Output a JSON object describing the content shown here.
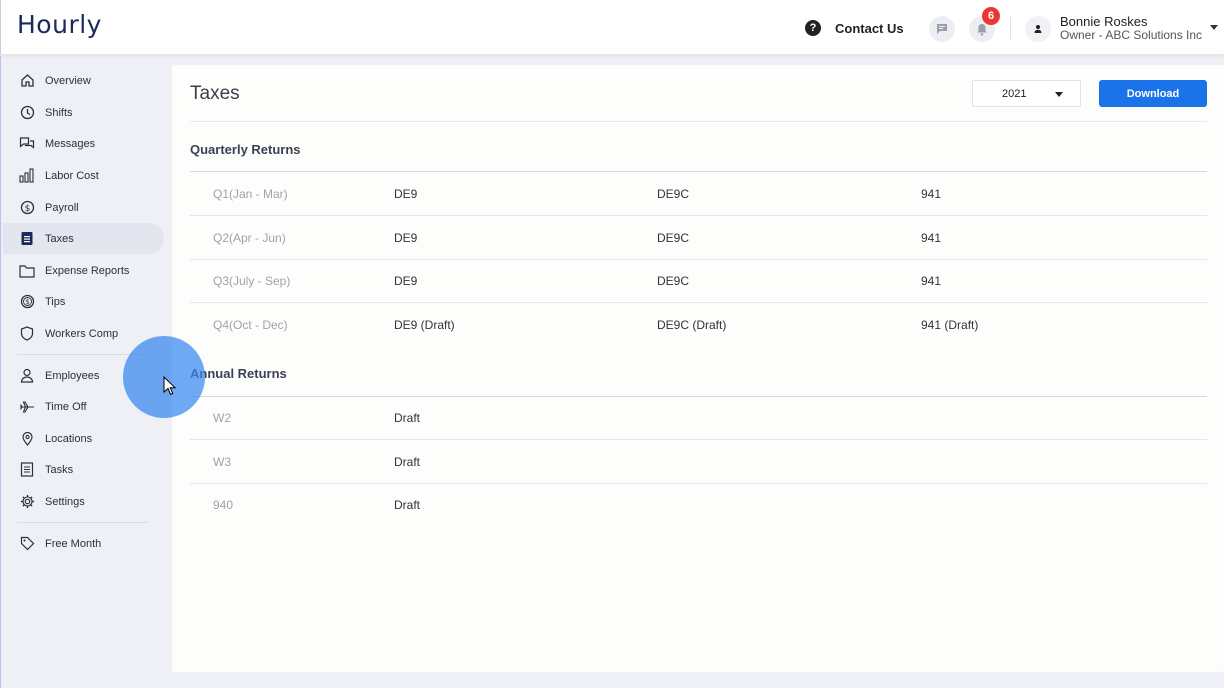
{
  "header": {
    "logo": "Hourly",
    "contact_label": "Contact Us",
    "notifications_count": "6",
    "user_name": "Bonnie Roskes",
    "user_role": "Owner - ABC Solutions Inc"
  },
  "sidebar": {
    "items": [
      {
        "label": "Overview",
        "icon": "home-icon"
      },
      {
        "label": "Shifts",
        "icon": "clock-icon"
      },
      {
        "label": "Messages",
        "icon": "chat-icon"
      },
      {
        "label": "Labor Cost",
        "icon": "bar-chart-icon"
      },
      {
        "label": "Payroll",
        "icon": "dollar-icon"
      },
      {
        "label": "Taxes",
        "icon": "document-icon",
        "active": true
      },
      {
        "label": "Expense Reports",
        "icon": "folder-icon"
      },
      {
        "label": "Tips",
        "icon": "coin-icon"
      },
      {
        "label": "Workers Comp",
        "icon": "shield-icon"
      },
      {
        "label": "Employees",
        "icon": "person-icon"
      },
      {
        "label": "Time Off",
        "icon": "plane-icon"
      },
      {
        "label": "Locations",
        "icon": "pin-icon"
      },
      {
        "label": "Tasks",
        "icon": "list-icon"
      },
      {
        "label": "Settings",
        "icon": "gear-icon"
      },
      {
        "label": "Free Month",
        "icon": "tag-icon"
      }
    ]
  },
  "main": {
    "title": "Taxes",
    "year": "2021",
    "download_label": "Download",
    "quarterly": {
      "title": "Quarterly Returns",
      "rows": [
        {
          "label": "Q1(Jan - Mar)",
          "c1": "DE9",
          "c2": "DE9C",
          "c3": "941"
        },
        {
          "label": "Q2(Apr - Jun)",
          "c1": "DE9",
          "c2": "DE9C",
          "c3": "941"
        },
        {
          "label": "Q3(July - Sep)",
          "c1": "DE9",
          "c2": "DE9C",
          "c3": "941"
        },
        {
          "label": "Q4(Oct - Dec)",
          "c1": "DE9 (Draft)",
          "c2": "DE9C (Draft)",
          "c3": "941 (Draft)"
        }
      ]
    },
    "annual": {
      "title": "Annual Returns",
      "rows": [
        {
          "label": "W2",
          "c1": "Draft"
        },
        {
          "label": "W3",
          "c1": "Draft"
        },
        {
          "label": "940",
          "c1": "Draft"
        }
      ]
    }
  },
  "colors": {
    "accent": "#1a73e8",
    "badge": "#e8392f",
    "logo": "#1b2a5c",
    "cursor_highlight": "#3886f0"
  }
}
